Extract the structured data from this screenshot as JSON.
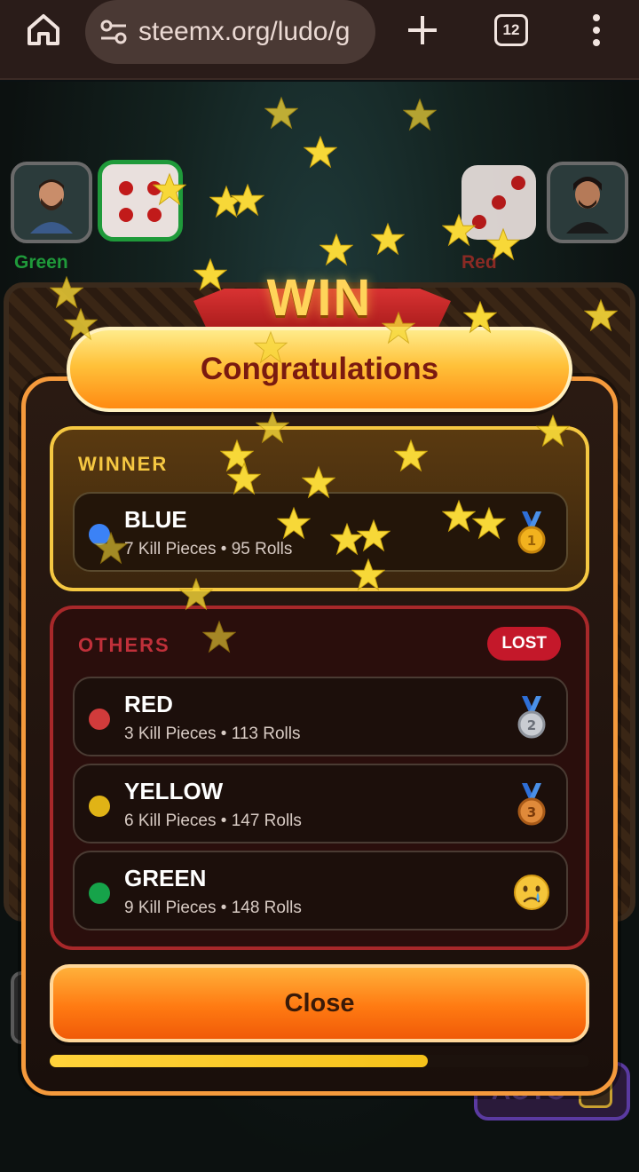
{
  "browser": {
    "url": "steemx.org/ludo/g",
    "tab_count": "12"
  },
  "game": {
    "players": [
      {
        "name": "Green",
        "color": "#1f9a3a"
      },
      {
        "name": "Red",
        "color": "#c0302a"
      }
    ],
    "banner_text": "WIN",
    "auto_label": "AUTO"
  },
  "modal": {
    "title": "Congratulations",
    "winner": {
      "heading": "WINNER",
      "name": "BLUE",
      "stats": "7 Kill Pieces • 95 Rolls",
      "color": "#3b82f6",
      "icon": "gold-medal-icon"
    },
    "others": {
      "heading": "OTHERS",
      "badge": "LOST",
      "rows": [
        {
          "name": "RED",
          "stats": "3 Kill Pieces • 113 Rolls",
          "color": "#d13b3b",
          "icon": "silver-medal-icon"
        },
        {
          "name": "YELLOW",
          "stats": "6 Kill Pieces • 147 Rolls",
          "color": "#e0b316",
          "icon": "bronze-medal-icon"
        },
        {
          "name": "GREEN",
          "stats": "9 Kill Pieces • 148 Rolls",
          "color": "#16a34a",
          "icon": "crying-face-icon"
        }
      ]
    },
    "close_label": "Close",
    "progress": 0.7
  }
}
